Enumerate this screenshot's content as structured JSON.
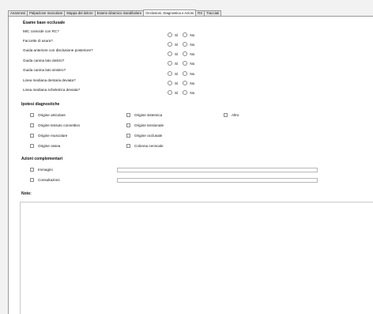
{
  "tabs": [
    {
      "label": "Anamnesi",
      "active": false
    },
    {
      "label": "Palpazione muscolare",
      "active": false
    },
    {
      "label": "Mappa del dolore",
      "active": false
    },
    {
      "label": "Esame dinamico mandibolare",
      "active": false
    },
    {
      "label": "Occlusioni, Diagnostica e Azioni",
      "active": true
    },
    {
      "label": "RX",
      "active": false
    },
    {
      "label": "Tracciati",
      "active": false
    }
  ],
  "exam": {
    "title": "Esame base occlusale",
    "yes_label": "Sì",
    "no_label": "No",
    "questions": [
      "MIC coincide con RC?",
      "Faccette di usura?",
      "Guida anteriore con disclusione posteriore?",
      "Guida canina lato destro?",
      "Guida canina lato sinistro?",
      "Linea mediana dentaria deviata?",
      "Linea mediana scheletrica deviata?"
    ]
  },
  "hypotheses": {
    "title": "Ipotesi diagnostiche",
    "col1": [
      "Origine articolare",
      "Origine tessuto connettivo",
      "Origine muscolare",
      "Origine ossea"
    ],
    "col2": [
      "Origine sistemica",
      "Origine tensionale",
      "Origine occlusale",
      "Colonna cervicale"
    ],
    "col3": [
      "Altro"
    ]
  },
  "actions": {
    "title": "Azioni complementari",
    "items": [
      "Immagini",
      "Consultazioni"
    ]
  },
  "notes": {
    "label": "Note:"
  }
}
